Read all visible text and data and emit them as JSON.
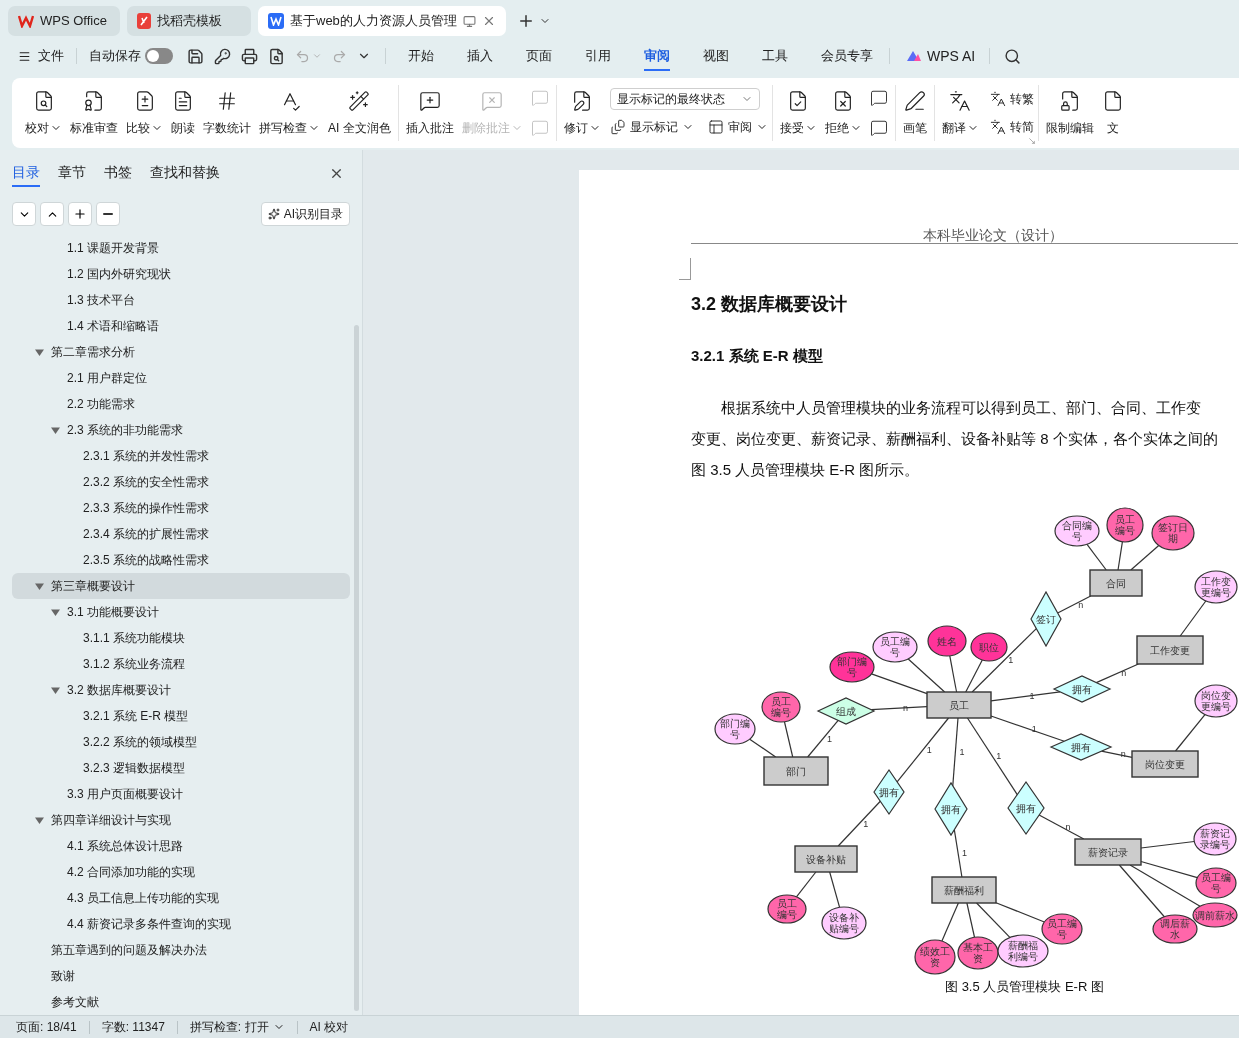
{
  "tabs": [
    {
      "label": "WPS Office",
      "kind": "home",
      "selected": false
    },
    {
      "label": "找稻壳模板",
      "kind": "template",
      "selected": false
    },
    {
      "label": "基于web的人力资源人员管理",
      "kind": "document",
      "selected": true
    }
  ],
  "menu": {
    "file": "文件",
    "autosave": {
      "label": "自动保存",
      "on": false
    },
    "tabs": [
      {
        "label": "开始",
        "selected": false
      },
      {
        "label": "插入",
        "selected": false
      },
      {
        "label": "页面",
        "selected": false
      },
      {
        "label": "引用",
        "selected": false
      },
      {
        "label": "审阅",
        "selected": true
      },
      {
        "label": "视图",
        "selected": false
      },
      {
        "label": "工具",
        "selected": false
      },
      {
        "label": "会员专享",
        "selected": false
      }
    ],
    "ai": "WPS AI"
  },
  "ribbon": {
    "groups": [
      {
        "items": [
          {
            "label": "校对",
            "kind": "large",
            "dropdown": true,
            "disabled": false
          },
          {
            "label": "标准审查",
            "kind": "large",
            "dropdown": false,
            "disabled": false
          },
          {
            "label": "比较",
            "kind": "large",
            "dropdown": true,
            "disabled": false
          },
          {
            "label": "朗读",
            "kind": "large",
            "dropdown": false,
            "disabled": false
          },
          {
            "label": "字数统计",
            "kind": "large",
            "dropdown": false,
            "disabled": false
          },
          {
            "label": "拼写检查",
            "kind": "large",
            "dropdown": true,
            "disabled": false
          },
          {
            "label": "AI 全文润色",
            "kind": "large",
            "dropdown": false,
            "disabled": false
          }
        ]
      },
      {
        "items": [
          {
            "label": "插入批注",
            "kind": "large",
            "dropdown": false,
            "disabled": false
          },
          {
            "label": "删除批注",
            "kind": "large",
            "dropdown": true,
            "disabled": true
          },
          {
            "kind": "icon-pair",
            "disabled": true
          }
        ]
      },
      {
        "items": [
          {
            "label": "修订",
            "kind": "large",
            "dropdown": true,
            "disabled": false
          },
          {
            "value": "显示标记的最终状态",
            "kind": "field"
          },
          {
            "label": "显示标记",
            "kind": "small",
            "dropdown": true,
            "disabled": false
          },
          {
            "label": "审阅",
            "kind": "small",
            "dropdown": true,
            "disabled": false
          }
        ]
      },
      {
        "items": [
          {
            "label": "接受",
            "kind": "large",
            "dropdown": true,
            "disabled": false
          },
          {
            "label": "拒绝",
            "kind": "large",
            "dropdown": true,
            "disabled": false
          },
          {
            "kind": "icon-pair",
            "disabled": false
          }
        ]
      },
      {
        "items": [
          {
            "label": "画笔",
            "kind": "large",
            "dropdown": false,
            "disabled": false
          }
        ]
      },
      {
        "items": [
          {
            "label": "翻译",
            "kind": "large",
            "dropdown": true,
            "disabled": false
          },
          {
            "label": "转繁",
            "kind": "small",
            "dropdown": false,
            "disabled": false
          },
          {
            "label": "转简",
            "kind": "small",
            "dropdown": false,
            "disabled": false
          }
        ]
      },
      {
        "items": [
          {
            "label": "限制编辑",
            "kind": "large",
            "dropdown": false,
            "disabled": false
          },
          {
            "label": "文",
            "kind": "large",
            "dropdown": false,
            "disabled": false
          }
        ]
      }
    ]
  },
  "sidebar": {
    "tabs": [
      {
        "label": "目录",
        "selected": true
      },
      {
        "label": "章节",
        "selected": false
      },
      {
        "label": "书签",
        "selected": false
      },
      {
        "label": "查找和替换",
        "selected": false
      }
    ],
    "ai_button": "AI识别目录",
    "toc": [
      {
        "children": [
          {
            "label": "1.1 课题开发背景",
            "selected": false
          },
          {
            "label": "1.2 国内外研究现状",
            "selected": false
          },
          {
            "label": "1.3 技术平台",
            "selected": false
          },
          {
            "label": "1.4 术语和缩略语",
            "selected": false
          }
        ]
      },
      {
        "label": "第二章需求分析",
        "selected": false,
        "expanded": true,
        "children": [
          {
            "label": "2.1 用户群定位",
            "selected": false
          },
          {
            "label": "2.2 功能需求",
            "selected": false
          },
          {
            "label": "2.3 系统的非功能需求",
            "selected": false,
            "expanded": true,
            "children": [
              {
                "label": "2.3.1 系统的并发性需求",
                "selected": false
              },
              {
                "label": "2.3.2 系统的安全性需求",
                "selected": false
              },
              {
                "label": "2.3.3 系统的操作性需求",
                "selected": false
              },
              {
                "label": "2.3.4 系统的扩展性需求",
                "selected": false
              },
              {
                "label": "2.3.5 系统的战略性需求",
                "selected": false
              }
            ]
          }
        ]
      },
      {
        "label": "第三章概要设计",
        "selected": true,
        "expanded": true,
        "children": [
          {
            "label": "3.1 功能概要设计",
            "selected": false,
            "expanded": true,
            "children": [
              {
                "label": "3.1.1 系统功能模块",
                "selected": false
              },
              {
                "label": "3.1.2 系统业务流程",
                "selected": false
              }
            ]
          },
          {
            "label": "3.2 数据库概要设计",
            "selected": false,
            "expanded": true,
            "children": [
              {
                "label": "3.2.1 系统 E-R 模型",
                "selected": false
              },
              {
                "label": "3.2.2 系统的领域模型",
                "selected": false
              },
              {
                "label": "3.2.3 逻辑数据模型",
                "selected": false
              }
            ]
          },
          {
            "label": "3.3 用户页面概要设计",
            "selected": false
          }
        ]
      },
      {
        "label": "第四章详细设计与实现",
        "selected": false,
        "expanded": true,
        "children": [
          {
            "label": "4.1 系统总体设计思路",
            "selected": false
          },
          {
            "label": "4.2 合同添加功能的实现",
            "selected": false
          },
          {
            "label": "4.3 员工信息上传功能的实现",
            "selected": false
          },
          {
            "label": "4.4 薪资记录多条件查询的实现",
            "selected": false
          }
        ]
      },
      {
        "label": "第五章遇到的问题及解决办法",
        "selected": false
      },
      {
        "label": "致谢",
        "selected": false
      },
      {
        "label": "参考文献",
        "selected": false
      }
    ]
  },
  "document": {
    "header": "本科毕业论文（设计）",
    "heading": "3.2 数据库概要设计",
    "subheading": "3.2.1 系统 E-R 模型",
    "paragraph": [
      "根据系统中人员管理模块的业务流程可以得到员工、部门、合同、工作变",
      "变更、岗位变更、薪资记录、薪酬福利、设备补贴等 8 个实体，各个实体之间的",
      "图 3.5 人员管理模块 E-R 图所示。"
    ],
    "er_diagram": {
      "entities": [
        {
          "label": "员工",
          "attributes": [
            {
              "label": "员工编号",
              "color": "#ffccff"
            },
            {
              "label": "姓名",
              "color": "#ff3399"
            },
            {
              "label": "职位",
              "color": "#ff3399"
            },
            {
              "label": "部门编号",
              "color": "#ff3399"
            }
          ]
        },
        {
          "label": "合同",
          "attributes": [
            {
              "label": "合同编号",
              "color": "#ffccff"
            },
            {
              "label": "员工编号",
              "color": "#ff66aa"
            },
            {
              "label": "签订日期",
              "color": "#ff66aa"
            }
          ]
        },
        {
          "label": "工作变更",
          "attributes": [
            {
              "label": "工作变更编号",
              "color": "#ffccff"
            }
          ]
        },
        {
          "label": "岗位变更",
          "attributes": [
            {
              "label": "岗位变更编号",
              "color": "#ffccff"
            }
          ]
        },
        {
          "label": "部门",
          "attributes": [
            {
              "label": "部门编号",
              "color": "#ffccff"
            },
            {
              "label": "员工编号",
              "color": "#ff66aa"
            }
          ]
        },
        {
          "label": "设备补贴",
          "attributes": [
            {
              "label": "员工编号",
              "color": "#ff66aa"
            },
            {
              "label": "设备补贴编号",
              "color": "#ffccff"
            }
          ]
        },
        {
          "label": "薪酬福利",
          "attributes": [
            {
              "label": "绩效工资",
              "color": "#ff66aa"
            },
            {
              "label": "基本工资",
              "color": "#ff66aa"
            },
            {
              "label": "薪酬福利编号",
              "color": "#ffccff"
            },
            {
              "label": "员工编号",
              "color": "#ff66aa"
            }
          ]
        },
        {
          "label": "薪资记录",
          "attributes": [
            {
              "label": "薪资记录编号",
              "color": "#ffccff"
            },
            {
              "label": "员工编号",
              "color": "#ff66aa"
            },
            {
              "label": "调后薪水",
              "color": "#ff66aa"
            },
            {
              "label": "调前薪水",
              "color": "#ff66aa"
            }
          ]
        }
      ],
      "relations": [
        {
          "label": "组成",
          "color": "#ccffe6",
          "links": [
            {
              "card": "n"
            },
            {
              "card": "1"
            }
          ]
        },
        {
          "label": "签订",
          "color": "#ccffff",
          "links": [
            {
              "card": "1"
            },
            {
              "card": "n"
            }
          ]
        },
        {
          "label": "拥有",
          "color": "#ccffff",
          "links": [
            {
              "card": "1"
            },
            {
              "card": "n"
            }
          ]
        },
        {
          "label": "拥有",
          "color": "#ccffff",
          "links": [
            {
              "card": "1"
            },
            {
              "card": "n"
            }
          ]
        },
        {
          "label": "拥有",
          "color": "#ccffff",
          "links": [
            {
              "card": "1"
            },
            {
              "card": "1"
            }
          ]
        },
        {
          "label": "拥有",
          "color": "#ccffff",
          "links": [
            {
              "card": "1"
            },
            {
              "card": "1"
            }
          ]
        },
        {
          "label": "拥有",
          "color": "#ccffff",
          "links": [
            {
              "card": "1"
            },
            {
              "card": "n"
            }
          ]
        }
      ]
    },
    "caption": "图 3.5 人员管理模块 E-R 图"
  },
  "status_bar": {
    "items": [
      {
        "label": "页面: 18/41",
        "dropdown": false
      },
      {
        "label": "字数: 11347",
        "dropdown": false
      },
      {
        "label": "拼写检查: 打开",
        "dropdown": true
      },
      {
        "label": "AI 校对",
        "dropdown": false
      }
    ]
  }
}
